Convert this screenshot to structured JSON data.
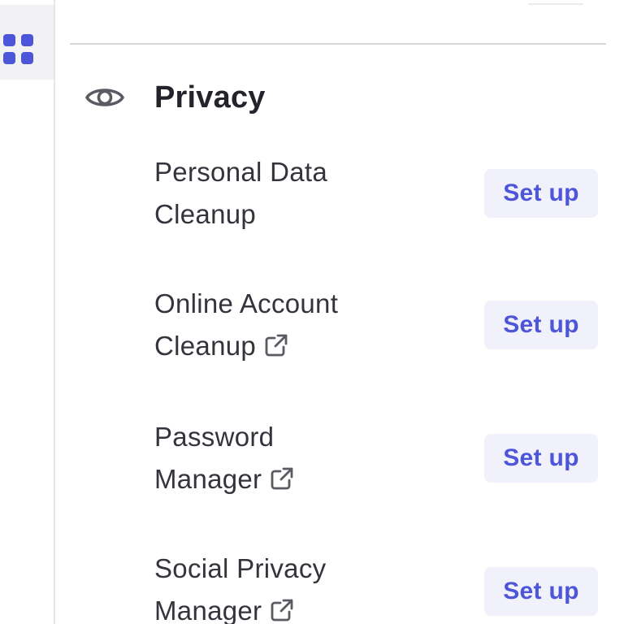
{
  "rail": {
    "active_icon": "apps-grid-icon",
    "accent_color": "#4d55d8"
  },
  "section": {
    "icon": "eye-icon",
    "title": "Privacy"
  },
  "features": [
    {
      "name_line1": "Personal Data",
      "name_line2": "Cleanup",
      "external_link": false,
      "button_label": "Set up"
    },
    {
      "name_line1": "Online Account",
      "name_line2": "Cleanup",
      "external_link": true,
      "button_label": "Set up"
    },
    {
      "name_line1": "Password",
      "name_line2": "Manager",
      "external_link": true,
      "button_label": "Set up"
    },
    {
      "name_line1": "Social Privacy",
      "name_line2": "Manager",
      "external_link": true,
      "button_label": "Set up"
    }
  ],
  "colors": {
    "title_text": "#23232b",
    "body_text": "#34343c",
    "button_bg": "#f1f1fb",
    "button_text": "#4d55d8",
    "divider": "#d8d8dc"
  }
}
